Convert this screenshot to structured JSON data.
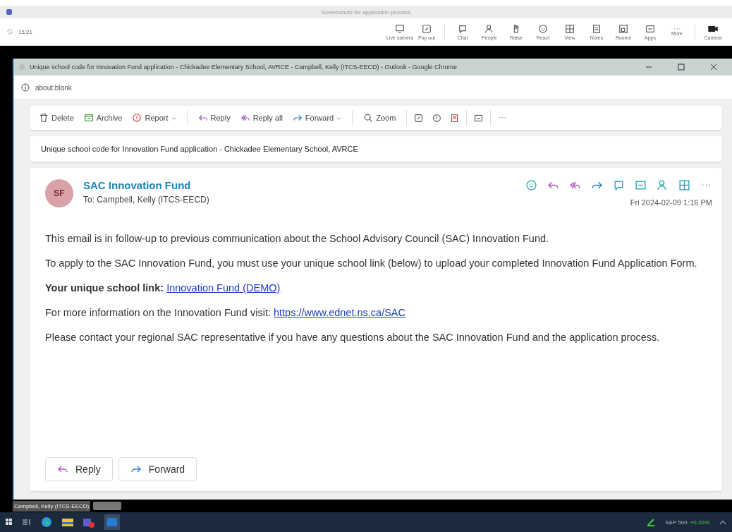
{
  "meeting": {
    "title": "Screenshots for application process",
    "timer": "15:21",
    "tools": [
      {
        "label": "Live camera"
      },
      {
        "label": "Pop out"
      },
      {
        "label": "Chat"
      },
      {
        "label": "People"
      },
      {
        "label": "Raise"
      },
      {
        "label": "React"
      },
      {
        "label": "View"
      },
      {
        "label": "Notes"
      },
      {
        "label": "Rooms"
      },
      {
        "label": "Apps"
      },
      {
        "label": "More"
      },
      {
        "label": "Camera"
      }
    ]
  },
  "browser": {
    "title": "Unique school code for Innovation Fund application - Chickadee Elementary School, AVRCE - Campbell, Kelly (ITCS-EECD) - Outlook - Google Chrome",
    "address": "about:blank"
  },
  "ribbon": [
    {
      "label": "Delete",
      "dropdown": false
    },
    {
      "label": "Archive",
      "dropdown": false
    },
    {
      "label": "Report",
      "dropdown": true
    },
    {
      "label": "Reply",
      "dropdown": false
    },
    {
      "label": "Reply all",
      "dropdown": false
    },
    {
      "label": "Forward",
      "dropdown": true
    },
    {
      "label": "Zoom",
      "dropdown": false
    }
  ],
  "subject": "Unique school code for Innovation Fund application - Chickadee Elementary School, AVRCE",
  "message": {
    "initials": "SF",
    "sender": "SAC Innovation Fund",
    "to": "To: Campbell, Kelly (ITCS-EECD)",
    "date": "Fri 2024-02-09 1:16 PM",
    "paragraphs": [
      {
        "kind": "text",
        "text": "This email is in follow-up to previous communication about the School Advisory Council (SAC) Innovation Fund."
      },
      {
        "kind": "text",
        "text": "To apply to the SAC Innovation Fund, you must use your unique school link (below) to upload your completed Innovation Fund Application Form."
      },
      {
        "kind": "link",
        "text": "**Your unique school link:** ",
        "link": "Innovation Fund (DEMO)"
      },
      {
        "kind": "link",
        "text": "For more information on the Innovation Fund visit: ",
        "link": "https://www.ednet.ns.ca/SAC"
      },
      {
        "kind": "text",
        "text": "Please contact your regional SAC representative if you have any questions about the SAC Innovation Fund and the application process."
      }
    ],
    "buttons": [
      {
        "label": "Reply"
      },
      {
        "label": "Forward"
      }
    ]
  },
  "participant": "Campbell, Kelly (ITCS-EECD)",
  "ticker": {
    "name": "S&P 500",
    "change": "+0.26%"
  }
}
